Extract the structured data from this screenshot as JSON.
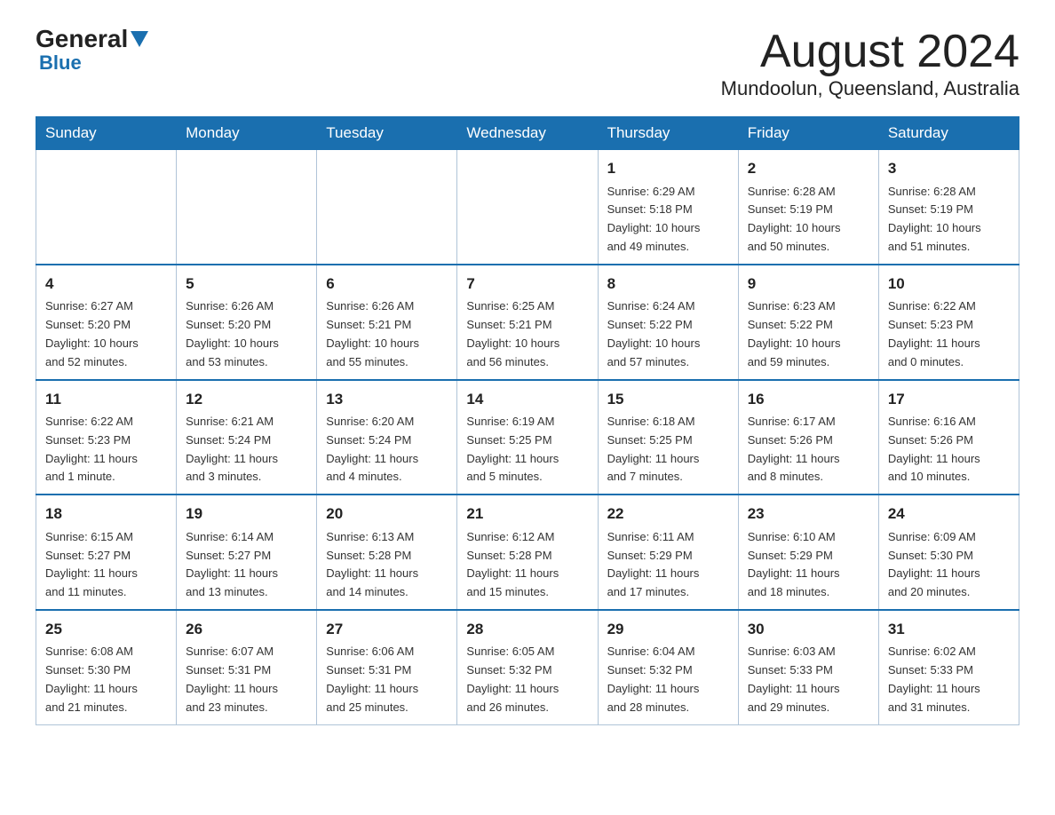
{
  "header": {
    "logo": {
      "general": "General",
      "blue": "Blue"
    },
    "month_title": "August 2024",
    "location": "Mundoolun, Queensland, Australia"
  },
  "days_of_week": [
    "Sunday",
    "Monday",
    "Tuesday",
    "Wednesday",
    "Thursday",
    "Friday",
    "Saturday"
  ],
  "weeks": [
    [
      {
        "day": "",
        "info": ""
      },
      {
        "day": "",
        "info": ""
      },
      {
        "day": "",
        "info": ""
      },
      {
        "day": "",
        "info": ""
      },
      {
        "day": "1",
        "info": "Sunrise: 6:29 AM\nSunset: 5:18 PM\nDaylight: 10 hours\nand 49 minutes."
      },
      {
        "day": "2",
        "info": "Sunrise: 6:28 AM\nSunset: 5:19 PM\nDaylight: 10 hours\nand 50 minutes."
      },
      {
        "day": "3",
        "info": "Sunrise: 6:28 AM\nSunset: 5:19 PM\nDaylight: 10 hours\nand 51 minutes."
      }
    ],
    [
      {
        "day": "4",
        "info": "Sunrise: 6:27 AM\nSunset: 5:20 PM\nDaylight: 10 hours\nand 52 minutes."
      },
      {
        "day": "5",
        "info": "Sunrise: 6:26 AM\nSunset: 5:20 PM\nDaylight: 10 hours\nand 53 minutes."
      },
      {
        "day": "6",
        "info": "Sunrise: 6:26 AM\nSunset: 5:21 PM\nDaylight: 10 hours\nand 55 minutes."
      },
      {
        "day": "7",
        "info": "Sunrise: 6:25 AM\nSunset: 5:21 PM\nDaylight: 10 hours\nand 56 minutes."
      },
      {
        "day": "8",
        "info": "Sunrise: 6:24 AM\nSunset: 5:22 PM\nDaylight: 10 hours\nand 57 minutes."
      },
      {
        "day": "9",
        "info": "Sunrise: 6:23 AM\nSunset: 5:22 PM\nDaylight: 10 hours\nand 59 minutes."
      },
      {
        "day": "10",
        "info": "Sunrise: 6:22 AM\nSunset: 5:23 PM\nDaylight: 11 hours\nand 0 minutes."
      }
    ],
    [
      {
        "day": "11",
        "info": "Sunrise: 6:22 AM\nSunset: 5:23 PM\nDaylight: 11 hours\nand 1 minute."
      },
      {
        "day": "12",
        "info": "Sunrise: 6:21 AM\nSunset: 5:24 PM\nDaylight: 11 hours\nand 3 minutes."
      },
      {
        "day": "13",
        "info": "Sunrise: 6:20 AM\nSunset: 5:24 PM\nDaylight: 11 hours\nand 4 minutes."
      },
      {
        "day": "14",
        "info": "Sunrise: 6:19 AM\nSunset: 5:25 PM\nDaylight: 11 hours\nand 5 minutes."
      },
      {
        "day": "15",
        "info": "Sunrise: 6:18 AM\nSunset: 5:25 PM\nDaylight: 11 hours\nand 7 minutes."
      },
      {
        "day": "16",
        "info": "Sunrise: 6:17 AM\nSunset: 5:26 PM\nDaylight: 11 hours\nand 8 minutes."
      },
      {
        "day": "17",
        "info": "Sunrise: 6:16 AM\nSunset: 5:26 PM\nDaylight: 11 hours\nand 10 minutes."
      }
    ],
    [
      {
        "day": "18",
        "info": "Sunrise: 6:15 AM\nSunset: 5:27 PM\nDaylight: 11 hours\nand 11 minutes."
      },
      {
        "day": "19",
        "info": "Sunrise: 6:14 AM\nSunset: 5:27 PM\nDaylight: 11 hours\nand 13 minutes."
      },
      {
        "day": "20",
        "info": "Sunrise: 6:13 AM\nSunset: 5:28 PM\nDaylight: 11 hours\nand 14 minutes."
      },
      {
        "day": "21",
        "info": "Sunrise: 6:12 AM\nSunset: 5:28 PM\nDaylight: 11 hours\nand 15 minutes."
      },
      {
        "day": "22",
        "info": "Sunrise: 6:11 AM\nSunset: 5:29 PM\nDaylight: 11 hours\nand 17 minutes."
      },
      {
        "day": "23",
        "info": "Sunrise: 6:10 AM\nSunset: 5:29 PM\nDaylight: 11 hours\nand 18 minutes."
      },
      {
        "day": "24",
        "info": "Sunrise: 6:09 AM\nSunset: 5:30 PM\nDaylight: 11 hours\nand 20 minutes."
      }
    ],
    [
      {
        "day": "25",
        "info": "Sunrise: 6:08 AM\nSunset: 5:30 PM\nDaylight: 11 hours\nand 21 minutes."
      },
      {
        "day": "26",
        "info": "Sunrise: 6:07 AM\nSunset: 5:31 PM\nDaylight: 11 hours\nand 23 minutes."
      },
      {
        "day": "27",
        "info": "Sunrise: 6:06 AM\nSunset: 5:31 PM\nDaylight: 11 hours\nand 25 minutes."
      },
      {
        "day": "28",
        "info": "Sunrise: 6:05 AM\nSunset: 5:32 PM\nDaylight: 11 hours\nand 26 minutes."
      },
      {
        "day": "29",
        "info": "Sunrise: 6:04 AM\nSunset: 5:32 PM\nDaylight: 11 hours\nand 28 minutes."
      },
      {
        "day": "30",
        "info": "Sunrise: 6:03 AM\nSunset: 5:33 PM\nDaylight: 11 hours\nand 29 minutes."
      },
      {
        "day": "31",
        "info": "Sunrise: 6:02 AM\nSunset: 5:33 PM\nDaylight: 11 hours\nand 31 minutes."
      }
    ]
  ]
}
